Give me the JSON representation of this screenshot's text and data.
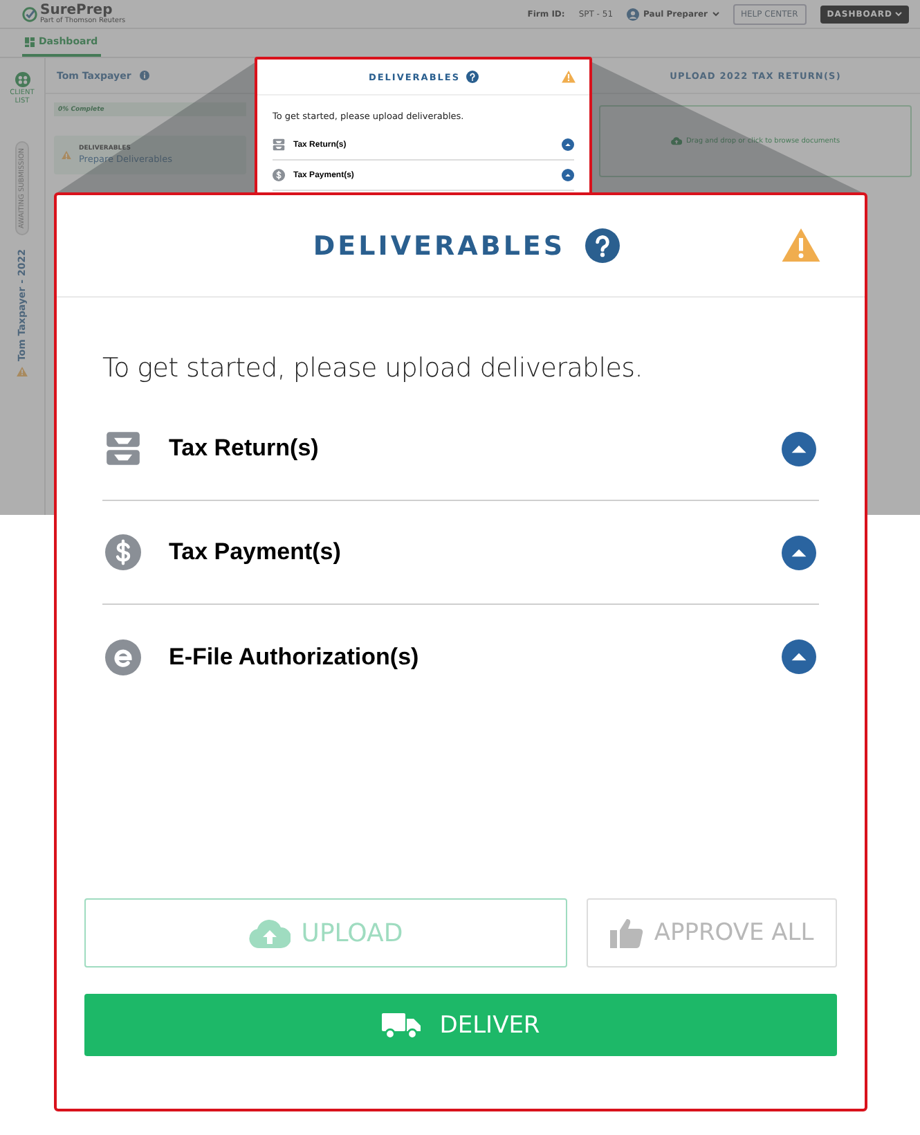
{
  "header": {
    "logo": "SurePrep",
    "logo_tagline": "Part of Thomson Reuters",
    "firm_id_label": "Firm ID:",
    "firm_id": "SPT - 51",
    "user": "Paul Preparer",
    "help_button": "HELP CENTER",
    "dashboard_button": "DASHBOARD"
  },
  "nav_tabs": [
    {
      "label": "Dashboard",
      "selected": true
    }
  ],
  "rail": {
    "client_list": "CLIENT LIST",
    "status_tag": "AWAITING SUBMISSION",
    "return_name": "Tom Taxpayer - 2022"
  },
  "client_panel": {
    "name": "Tom Taxpayer",
    "progress_label": "0% Complete",
    "level": 0,
    "task_label": "DELIVERABLES",
    "task_link": "Prepare Deliverables"
  },
  "upload_panel": {
    "title": "UPLOAD 2022 TAX RETURN(S)",
    "dropzone": "Drag and drop or click to browse documents"
  },
  "callout_small": {
    "title": "DELIVERABLES",
    "intro": "To get started, please upload deliverables.",
    "items": [
      {
        "kind": "tray",
        "label": "Tax Return(s)"
      },
      {
        "kind": "dollar",
        "label": "Tax Payment(s)"
      }
    ]
  },
  "deliverables": {
    "title": "DELIVERABLES",
    "intro": "To get started, please upload deliverables.",
    "items": [
      {
        "kind": "tray",
        "label": "Tax Return(s)"
      },
      {
        "kind": "dollar",
        "label": "Tax Payment(s)"
      },
      {
        "kind": "efile",
        "label": "E-File Authorization(s)"
      }
    ],
    "upload_button": {
      "label": "UPLOAD",
      "disabled": true
    },
    "approve_button": {
      "label": "APPROVE ALL",
      "disabled": true
    },
    "deliver_button": {
      "label": "DELIVER",
      "disabled": false
    }
  }
}
